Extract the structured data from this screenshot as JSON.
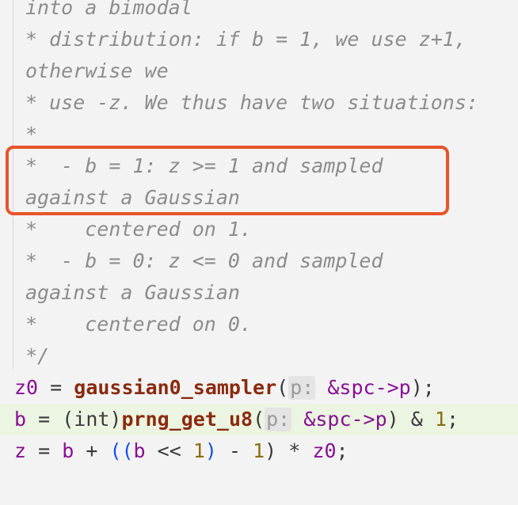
{
  "comment_lines": [
    "into a bimodal",
    "* distribution: if b = 1, we use z+1,",
    "otherwise we",
    "* use -z. We thus have two situations:",
    "*",
    "*  - b = 1: z >= 1 and sampled",
    "against a Gaussian",
    "*    centered on 1.",
    "*  - b = 0: z <= 0 and sampled",
    "against a Gaussian",
    "*    centered on 0.",
    "*/"
  ],
  "code": {
    "line1": {
      "var": "z0",
      "eq": " = ",
      "fn": "gaussian0_sampler",
      "open": "(",
      "hint": "p:",
      "arg": " &spc->p",
      "close": ");"
    },
    "line2": {
      "var": "b",
      "eq": " = ",
      "cast": "(int)",
      "fn": "prng_get_u8",
      "open": "(",
      "hint": "p:",
      "arg": " &spc->p",
      "close": ")",
      "and": " & ",
      "num": "1",
      "end": ";"
    },
    "line3": {
      "var": "z",
      "eq": " = ",
      "b": "b",
      "plus": " + ",
      "p1": "((",
      "b2": "b",
      "shift": " << ",
      "num1": "1",
      "p2": ")",
      "minus": " - ",
      "num2": "1",
      "p3": ")",
      "mul": " * ",
      "z0": "z0",
      "end": ";"
    }
  },
  "colors": {
    "highlight_box": "#e8542a",
    "current_line": "#ebf5e1"
  }
}
